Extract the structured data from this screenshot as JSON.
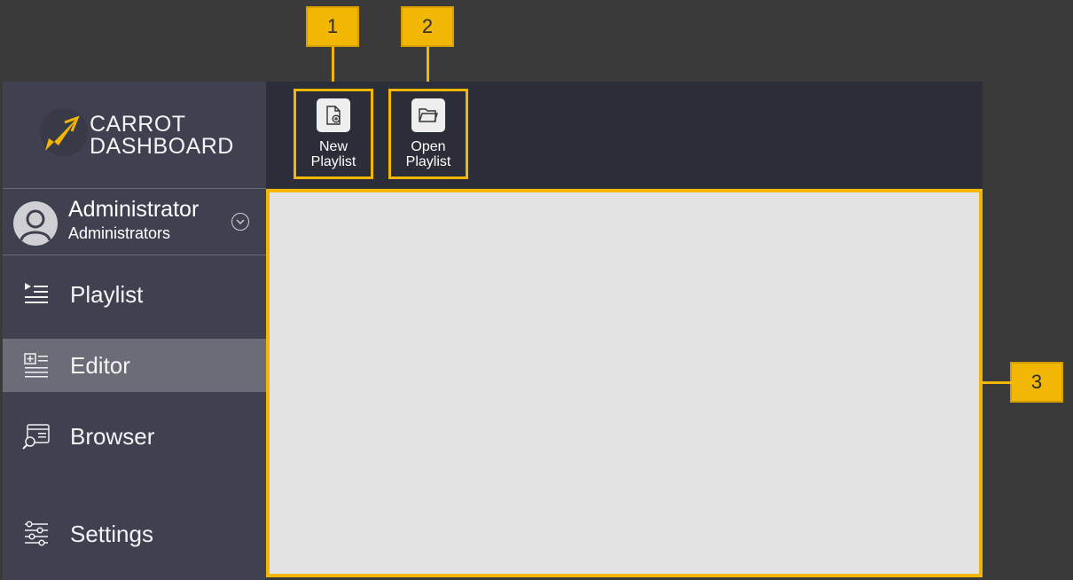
{
  "callouts": [
    "1",
    "2",
    "3"
  ],
  "app": {
    "logo": {
      "line1": "CARROT",
      "line2": "DASHBOARD"
    },
    "user": {
      "name": "Administrator",
      "group": "Administrators"
    },
    "nav": [
      {
        "label": "Playlist",
        "icon": "playlist-icon"
      },
      {
        "label": "Editor",
        "icon": "editor-icon",
        "active": true
      },
      {
        "label": "Browser",
        "icon": "browser-icon"
      },
      {
        "label": "Settings",
        "icon": "settings-icon"
      }
    ],
    "toolbar": {
      "new_playlist": {
        "line1": "New",
        "line2": "Playlist"
      },
      "open_playlist": {
        "line1": "Open",
        "line2": "Playlist"
      }
    }
  },
  "colors": {
    "callout": "#f2b705",
    "sidebar": "#3f4050",
    "toolbar": "#2b2d38",
    "content": "#e3e3e3",
    "active_nav": "#6b6c78",
    "background": "#3a3a3a"
  }
}
